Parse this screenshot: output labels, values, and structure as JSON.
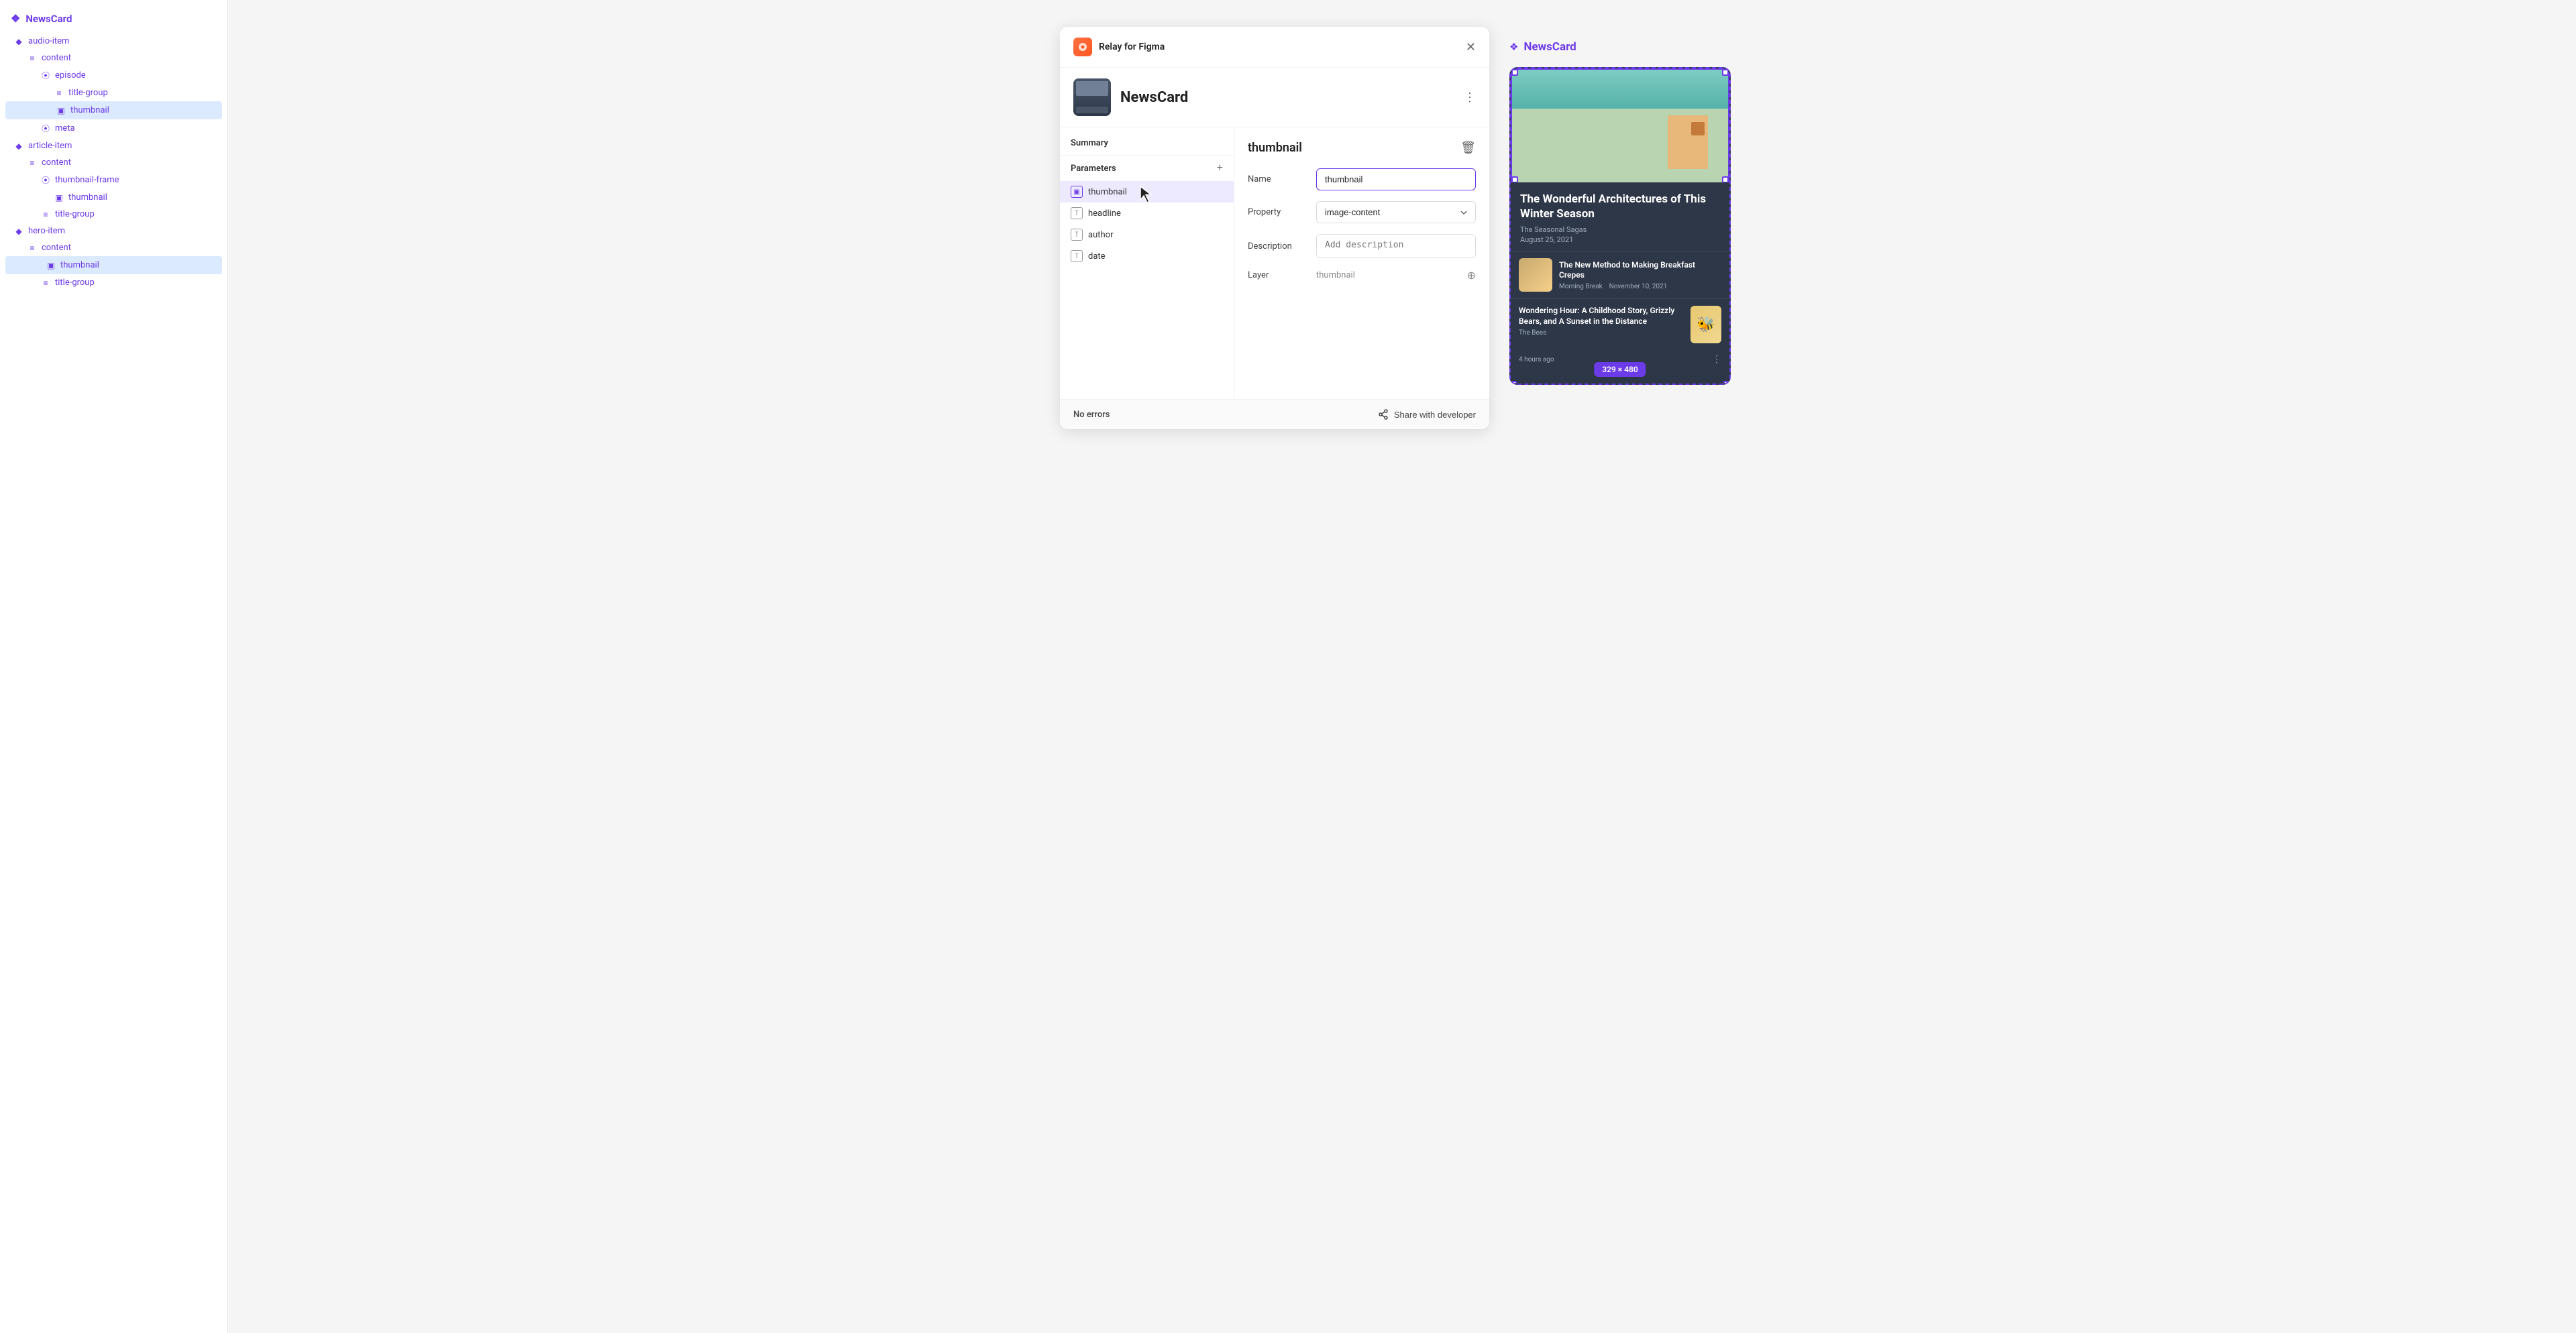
{
  "app": {
    "title": "NewsCard",
    "relay_title": "Relay for Figma"
  },
  "sidebar": {
    "root": "NewsCard",
    "items": [
      {
        "id": "audio-item",
        "label": "audio-item",
        "icon": "diamond",
        "indent": 1
      },
      {
        "id": "content",
        "label": "content",
        "icon": "lines",
        "indent": 2
      },
      {
        "id": "episode",
        "label": "episode",
        "icon": "bars",
        "indent": 3
      },
      {
        "id": "title-group",
        "label": "title-group",
        "icon": "lines",
        "indent": 4
      },
      {
        "id": "thumbnail-1",
        "label": "thumbnail",
        "icon": "img",
        "indent": 4,
        "active": true
      },
      {
        "id": "meta",
        "label": "meta",
        "icon": "bars",
        "indent": 3
      },
      {
        "id": "article-item",
        "label": "article-item",
        "icon": "diamond",
        "indent": 1
      },
      {
        "id": "content-2",
        "label": "content",
        "icon": "lines",
        "indent": 2
      },
      {
        "id": "thumbnail-frame",
        "label": "thumbnail-frame",
        "icon": "bars",
        "indent": 3
      },
      {
        "id": "thumbnail-2",
        "label": "thumbnail",
        "icon": "img",
        "indent": 4,
        "active": false
      },
      {
        "id": "title-group-2",
        "label": "title-group",
        "icon": "lines",
        "indent": 3
      },
      {
        "id": "hero-item",
        "label": "hero-item",
        "icon": "diamond",
        "indent": 1
      },
      {
        "id": "content-3",
        "label": "content",
        "icon": "lines",
        "indent": 2
      },
      {
        "id": "thumbnail-3",
        "label": "thumbnail",
        "icon": "img",
        "indent": 3,
        "active": true
      },
      {
        "id": "title-group-3",
        "label": "title-group",
        "icon": "lines",
        "indent": 3
      }
    ]
  },
  "relay_panel": {
    "component_name": "NewsCard",
    "summary_label": "Summary",
    "parameters_label": "Parameters",
    "add_button": "+",
    "params": [
      {
        "id": "thumbnail",
        "label": "thumbnail",
        "type": "img"
      },
      {
        "id": "headline",
        "label": "headline",
        "type": "text"
      },
      {
        "id": "author",
        "label": "author",
        "type": "text"
      },
      {
        "id": "date",
        "label": "date",
        "type": "text"
      }
    ],
    "detail": {
      "title": "thumbnail",
      "name_label": "Name",
      "name_value": "thumbnail",
      "property_label": "Property",
      "property_value": "image-content",
      "description_label": "Description",
      "description_placeholder": "Add description",
      "layer_label": "Layer",
      "layer_value": "thumbnail"
    },
    "footer": {
      "status": "No errors",
      "share_label": "Share with developer"
    }
  },
  "preview": {
    "title": "NewsCard",
    "cards": [
      {
        "type": "hero",
        "title": "The Wonderful Architectures of This Winter Season",
        "source": "The Seasonal Sagas",
        "date": "August 25, 2021"
      },
      {
        "type": "small",
        "title": "The New Method to Making Breakfast Crepes",
        "source": "Morning Break",
        "date": "November 10, 2021"
      },
      {
        "type": "last",
        "title": "Wondering Hour: A Childhood Story, Grizzly Bears, and A Sunset in the Distance",
        "source": "The Bees",
        "time": "4 hours ago"
      }
    ],
    "size_badge": "329 × 480"
  },
  "icons": {
    "grid": "❖",
    "diamond": "◆",
    "lines": "≡",
    "bars": "⦿",
    "img": "🖼",
    "close": "✕",
    "menu_dots": "⋮",
    "add": "+",
    "delete": "🗑",
    "crosshair": "⊕",
    "share": "⤴",
    "cursor": "↖"
  }
}
